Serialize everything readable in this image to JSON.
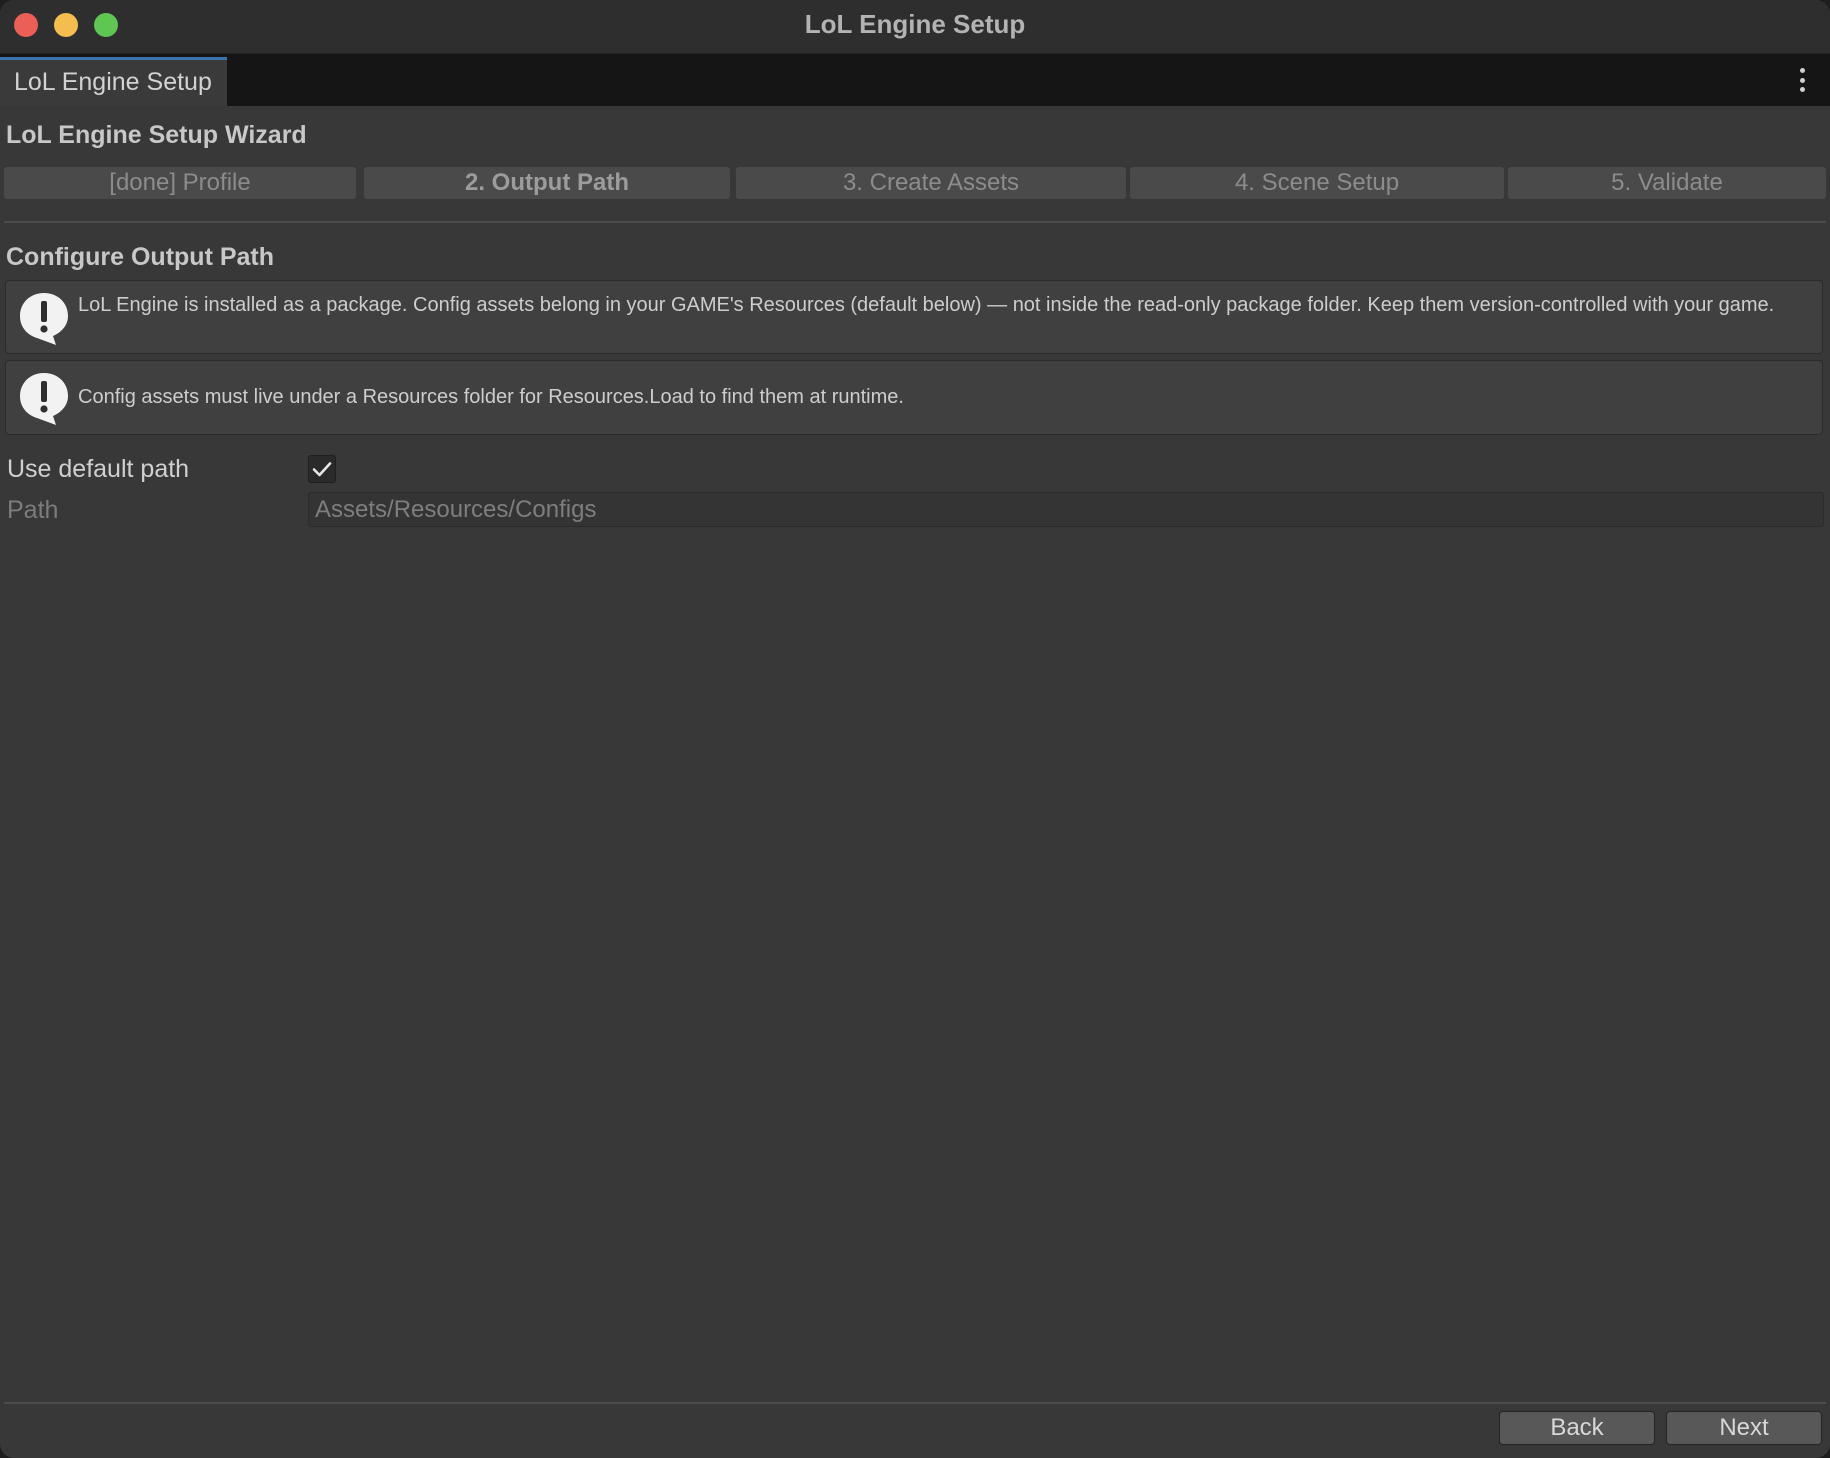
{
  "window": {
    "title": "LoL Engine Setup"
  },
  "tabbar": {
    "active_tab": "LoL Engine Setup",
    "menu_icon": "kebab-menu-icon"
  },
  "wizard": {
    "title": "LoL Engine Setup Wizard",
    "steps": [
      {
        "label": "[done] Profile",
        "state": "done"
      },
      {
        "label": "2. Output Path",
        "state": "active"
      },
      {
        "label": "3. Create Assets",
        "state": "pending"
      },
      {
        "label": "4. Scene Setup",
        "state": "pending"
      },
      {
        "label": "5. Validate",
        "state": "pending"
      }
    ]
  },
  "section": {
    "title": "Configure Output Path",
    "info_messages": [
      {
        "icon": "info-icon",
        "text": "LoL Engine is installed as a package. Config assets belong in your GAME's Resources (default below) — not inside the read-only package folder. Keep them version-controlled with your game."
      },
      {
        "icon": "info-icon",
        "text": "Config assets must live under a Resources folder for Resources.Load to find them at runtime."
      }
    ]
  },
  "fields": {
    "use_default": {
      "label": "Use default path",
      "checked": true
    },
    "path": {
      "label": "Path",
      "value": "Assets/Resources/Configs",
      "enabled": false
    }
  },
  "footer": {
    "back_label": "Back",
    "next_label": "Next"
  },
  "colors": {
    "background": "#383838",
    "tab_accent": "#3a72b0",
    "close": "#ec5f57",
    "minimize": "#f3bd4f",
    "maximize": "#5fc651"
  }
}
